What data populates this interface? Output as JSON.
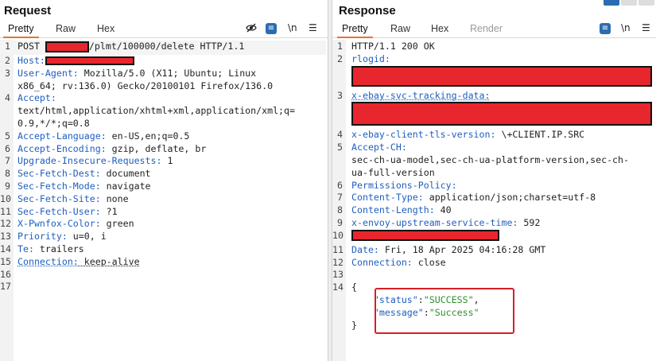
{
  "request": {
    "title": "Request",
    "tabs": [
      "Pretty",
      "Raw",
      "Hex"
    ],
    "icons": [
      "eye-slash-icon",
      "wrap-icon",
      "newline-icon",
      "menu-icon"
    ],
    "newline_label": "\\n",
    "lines": [
      {
        "n": "1",
        "parts": [
          {
            "t": "POST ",
            "c": "plain"
          },
          {
            "redact": true,
            "w": 55,
            "h": 14
          },
          {
            "t": "/plmt/100000/delete HTTP/1.1",
            "c": "plain"
          }
        ]
      },
      {
        "n": "2",
        "parts": [
          {
            "t": "Host:",
            "c": "hk"
          },
          {
            "redact": true,
            "w": 112,
            "h": 11
          }
        ]
      },
      {
        "n": "3",
        "parts": [
          {
            "t": "User-Agent:",
            "c": "hk"
          },
          {
            "t": " Mozilla/5.0 (X11; Ubuntu; Linux",
            "c": "plain"
          }
        ]
      },
      {
        "n": "",
        "parts": [
          {
            "t": "x86_64; rv:136.0) Gecko/20100101 Firefox/136.0",
            "c": "plain"
          }
        ]
      },
      {
        "n": "4",
        "parts": [
          {
            "t": "Accept:",
            "c": "hk"
          }
        ]
      },
      {
        "n": "",
        "parts": [
          {
            "t": "text/html,application/xhtml+xml,application/xml;q=",
            "c": "plain"
          }
        ]
      },
      {
        "n": "",
        "parts": [
          {
            "t": "0.9,*/*;q=0.8",
            "c": "plain"
          }
        ]
      },
      {
        "n": "5",
        "parts": [
          {
            "t": "Accept-Language:",
            "c": "hk"
          },
          {
            "t": " en-US,en;q=0.5",
            "c": "plain"
          }
        ]
      },
      {
        "n": "6",
        "parts": [
          {
            "t": "Accept-Encoding:",
            "c": "hk"
          },
          {
            "t": " gzip, deflate, br",
            "c": "plain"
          }
        ]
      },
      {
        "n": "7",
        "parts": [
          {
            "t": "Upgrade-Insecure-Requests:",
            "c": "hk"
          },
          {
            "t": " 1",
            "c": "plain"
          }
        ]
      },
      {
        "n": "8",
        "parts": [
          {
            "t": "Sec-Fetch-Dest:",
            "c": "hk"
          },
          {
            "t": " document",
            "c": "plain"
          }
        ]
      },
      {
        "n": "9",
        "parts": [
          {
            "t": "Sec-Fetch-Mode:",
            "c": "hk"
          },
          {
            "t": " navigate",
            "c": "plain"
          }
        ]
      },
      {
        "n": "10",
        "parts": [
          {
            "t": "Sec-Fetch-Site:",
            "c": "hk"
          },
          {
            "t": " none",
            "c": "plain"
          }
        ]
      },
      {
        "n": "11",
        "parts": [
          {
            "t": "Sec-Fetch-User:",
            "c": "hk"
          },
          {
            "t": " ?1",
            "c": "plain"
          }
        ]
      },
      {
        "n": "12",
        "parts": [
          {
            "t": "X-Pwnfox-Color:",
            "c": "hk"
          },
          {
            "t": " green",
            "c": "plain"
          }
        ]
      },
      {
        "n": "13",
        "parts": [
          {
            "t": "Priority:",
            "c": "hk"
          },
          {
            "t": " u=0, i",
            "c": "plain"
          }
        ]
      },
      {
        "n": "14",
        "parts": [
          {
            "t": "Te:",
            "c": "hk"
          },
          {
            "t": " trailers",
            "c": "plain"
          }
        ]
      },
      {
        "n": "15",
        "parts": [
          {
            "t": "Connection:",
            "c": "hk dotted"
          },
          {
            "t": " keep-alive",
            "c": "plain dotted"
          }
        ]
      },
      {
        "n": "16",
        "parts": []
      },
      {
        "n": "17",
        "parts": []
      }
    ]
  },
  "response": {
    "title": "Response",
    "tabs": [
      "Pretty",
      "Raw",
      "Hex",
      "Render"
    ],
    "icons": [
      "wrap-icon",
      "newline-icon",
      "menu-icon"
    ],
    "newline_label": "\\n",
    "lines": [
      {
        "n": "1",
        "parts": [
          {
            "t": "HTTP/1.1 200 OK",
            "c": "plain"
          }
        ]
      },
      {
        "n": "2",
        "parts": [
          {
            "t": "rlogid:",
            "c": "hk"
          }
        ]
      },
      {
        "n": "",
        "parts": [
          {
            "redact": true,
            "w": 378,
            "h": 26
          }
        ]
      },
      {
        "n": "3",
        "parts": [
          {
            "t": "x-ebay-svc-tracking-data:",
            "c": "hk dotted"
          }
        ]
      },
      {
        "n": "",
        "parts": [
          {
            "redact": true,
            "w": 378,
            "h": 30
          }
        ]
      },
      {
        "n": "4",
        "parts": [
          {
            "t": "x-ebay-client-tls-version:",
            "c": "hk"
          },
          {
            "t": " \\+CLIENT.IP.SRC",
            "c": "plain"
          }
        ]
      },
      {
        "n": "5",
        "parts": [
          {
            "t": "Accept-CH:",
            "c": "hk"
          }
        ]
      },
      {
        "n": "",
        "parts": [
          {
            "t": "sec-ch-ua-model,sec-ch-ua-platform-version,sec-ch-",
            "c": "plain"
          }
        ]
      },
      {
        "n": "",
        "parts": [
          {
            "t": "ua-full-version",
            "c": "plain"
          }
        ]
      },
      {
        "n": "6",
        "parts": [
          {
            "t": "Permissions-Policy:",
            "c": "hk"
          }
        ]
      },
      {
        "n": "7",
        "parts": [
          {
            "t": "Content-Type:",
            "c": "hk"
          },
          {
            "t": " application/json;charset=utf-8",
            "c": "plain"
          }
        ]
      },
      {
        "n": "8",
        "parts": [
          {
            "t": "Content-Length:",
            "c": "hk"
          },
          {
            "t": " 40",
            "c": "plain"
          }
        ]
      },
      {
        "n": "9",
        "parts": [
          {
            "t": "x-envoy-upstream-service-time:",
            "c": "hk"
          },
          {
            "t": " 592",
            "c": "plain"
          }
        ]
      },
      {
        "n": "10",
        "parts": [
          {
            "redact": true,
            "w": 186,
            "h": 14
          }
        ]
      },
      {
        "n": "11",
        "parts": [
          {
            "t": "Date:",
            "c": "hk"
          },
          {
            "t": " Fri, 18 Apr 2025 04:16:28 GMT",
            "c": "plain"
          }
        ]
      },
      {
        "n": "12",
        "parts": [
          {
            "t": "Connection:",
            "c": "hk"
          },
          {
            "t": " close",
            "c": "plain"
          }
        ]
      },
      {
        "n": "13",
        "parts": []
      },
      {
        "n": "14",
        "parts": [
          {
            "t": "{",
            "c": "plain"
          }
        ]
      },
      {
        "n": "",
        "parts": [
          {
            "t": "    ",
            "c": "plain"
          },
          {
            "t": "\"status\"",
            "c": "jk"
          },
          {
            "t": ":",
            "c": "plain"
          },
          {
            "t": "\"SUCCESS\"",
            "c": "js"
          },
          {
            "t": ",",
            "c": "plain"
          }
        ]
      },
      {
        "n": "",
        "parts": [
          {
            "t": "    ",
            "c": "plain"
          },
          {
            "t": "\"message\"",
            "c": "jk"
          },
          {
            "t": ":",
            "c": "plain"
          },
          {
            "t": "\"Success\"",
            "c": "js"
          }
        ]
      },
      {
        "n": "",
        "parts": [
          {
            "t": "}",
            "c": "plain"
          }
        ]
      }
    ]
  },
  "colors": {
    "accent": "#e8742e",
    "header_key": "#1f5fbf",
    "json_string": "#2a8f2a",
    "redaction": "#e8262d",
    "annotation_box": "#d61f26"
  }
}
